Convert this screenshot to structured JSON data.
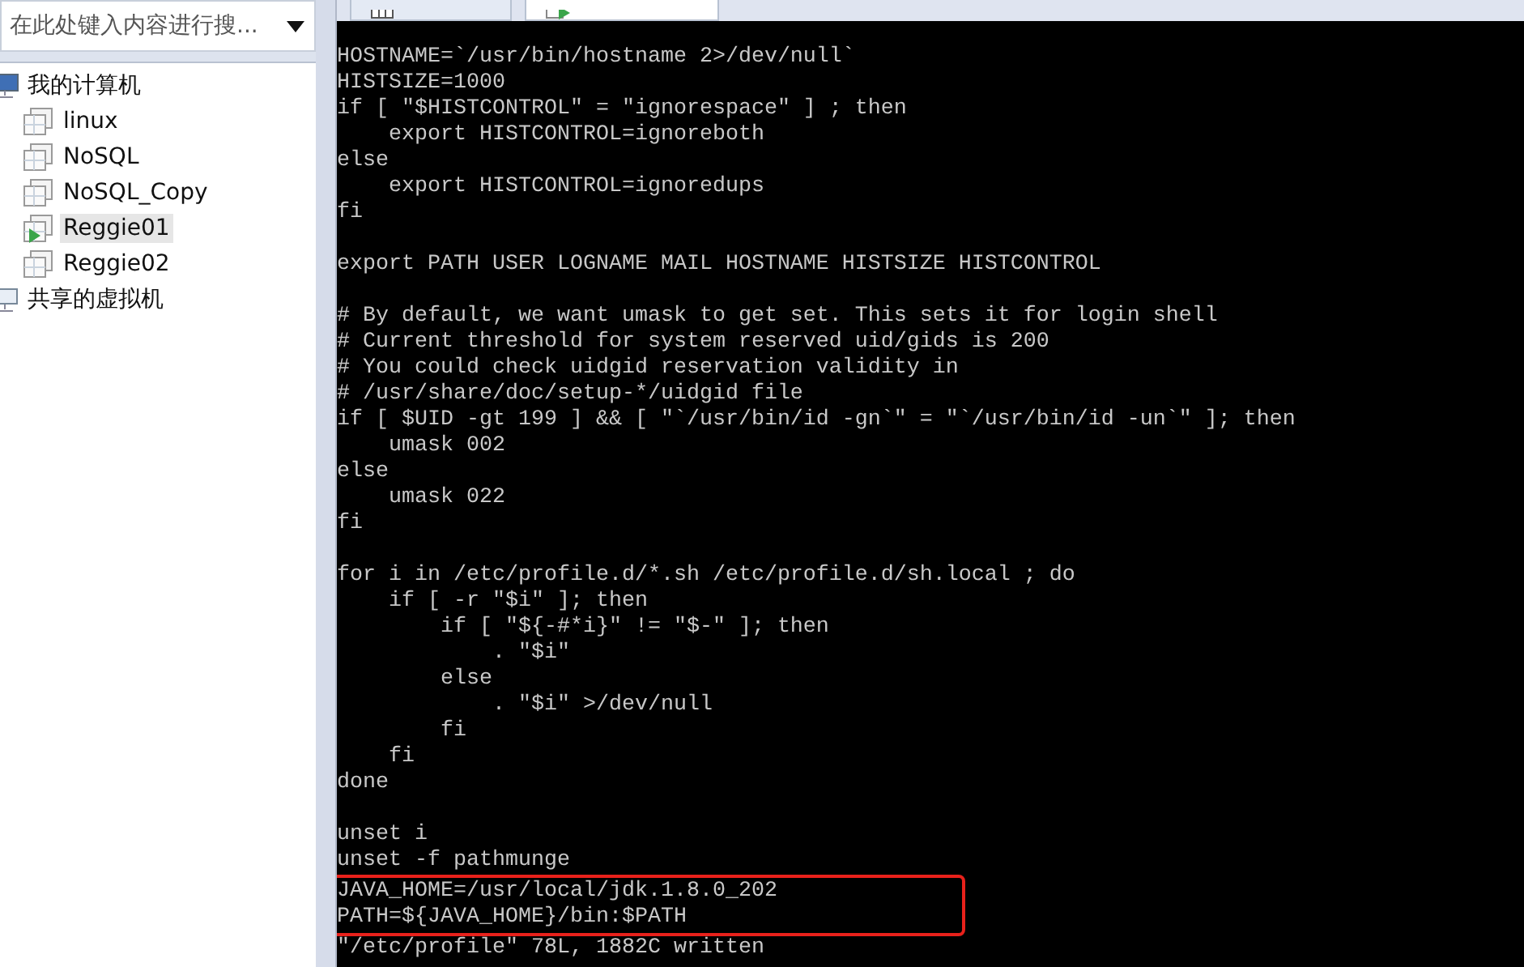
{
  "search": {
    "placeholder": "在此处键入内容进行搜..."
  },
  "tree": [
    {
      "label": "我的计算机",
      "kind": "computer",
      "children": [
        {
          "label": "linux",
          "selected": false,
          "running": false
        },
        {
          "label": "NoSQL",
          "selected": false,
          "running": false
        },
        {
          "label": "NoSQL_Copy",
          "selected": false,
          "running": false
        },
        {
          "label": "Reggie01",
          "selected": true,
          "running": true
        },
        {
          "label": "Reggie02",
          "selected": false,
          "running": false
        }
      ]
    },
    {
      "label": "共享的虚拟机",
      "kind": "shared"
    }
  ],
  "tabs": [
    {
      "kind": "home",
      "selected": false
    },
    {
      "kind": "vm",
      "selected": true
    }
  ],
  "terminal": {
    "blocks": [
      [
        {
          "text": "HOSTNAME=`/usr/bin/hostname 2>/dev/null`",
          "highlighted": false
        },
        {
          "text": "HISTSIZE=1000",
          "highlighted": false
        },
        {
          "text": "if [ \"$HISTCONTROL\" = \"ignorespace\" ] ; then",
          "highlighted": false
        },
        {
          "text": "    export HISTCONTROL=ignoreboth",
          "highlighted": false
        },
        {
          "text": "else",
          "highlighted": false
        },
        {
          "text": "    export HISTCONTROL=ignoredups",
          "highlighted": false
        },
        {
          "text": "fi",
          "highlighted": false
        }
      ],
      [
        {
          "text": "export PATH USER LOGNAME MAIL HOSTNAME HISTSIZE HISTCONTROL",
          "highlighted": false
        }
      ],
      [
        {
          "text": "# By default, we want umask to get set. This sets it for login shell",
          "highlighted": false
        },
        {
          "text": "# Current threshold for system reserved uid/gids is 200",
          "highlighted": false
        },
        {
          "text": "# You could check uidgid reservation validity in",
          "highlighted": false
        },
        {
          "text": "# /usr/share/doc/setup-*/uidgid file",
          "highlighted": false
        },
        {
          "text": "if [ $UID -gt 199 ] && [ \"`/usr/bin/id -gn`\" = \"`/usr/bin/id -un`\" ]; then",
          "highlighted": false
        },
        {
          "text": "    umask 002",
          "highlighted": false
        },
        {
          "text": "else",
          "highlighted": false
        },
        {
          "text": "    umask 022",
          "highlighted": false
        },
        {
          "text": "fi",
          "highlighted": false
        }
      ],
      [
        {
          "text": "for i in /etc/profile.d/*.sh /etc/profile.d/sh.local ; do",
          "highlighted": false
        },
        {
          "text": "    if [ -r \"$i\" ]; then",
          "highlighted": false
        },
        {
          "text": "        if [ \"${-#*i}\" != \"$-\" ]; then",
          "highlighted": false
        },
        {
          "text": "            . \"$i\"",
          "highlighted": false
        },
        {
          "text": "        else",
          "highlighted": false
        },
        {
          "text": "            . \"$i\" >/dev/null",
          "highlighted": false
        },
        {
          "text": "        fi",
          "highlighted": false
        },
        {
          "text": "    fi",
          "highlighted": false
        },
        {
          "text": "done",
          "highlighted": false
        }
      ],
      [
        {
          "text": "unset i",
          "highlighted": false
        },
        {
          "text": "unset -f pathmunge",
          "highlighted": false
        },
        {
          "text": "JAVA_HOME=/usr/local/jdk.1.8.0_202",
          "highlighted": true
        },
        {
          "text": "PATH=${JAVA_HOME}/bin:$PATH",
          "highlighted": true
        },
        {
          "text": "\"/etc/profile\" 78L, 1882C written",
          "highlighted": false
        }
      ]
    ]
  }
}
